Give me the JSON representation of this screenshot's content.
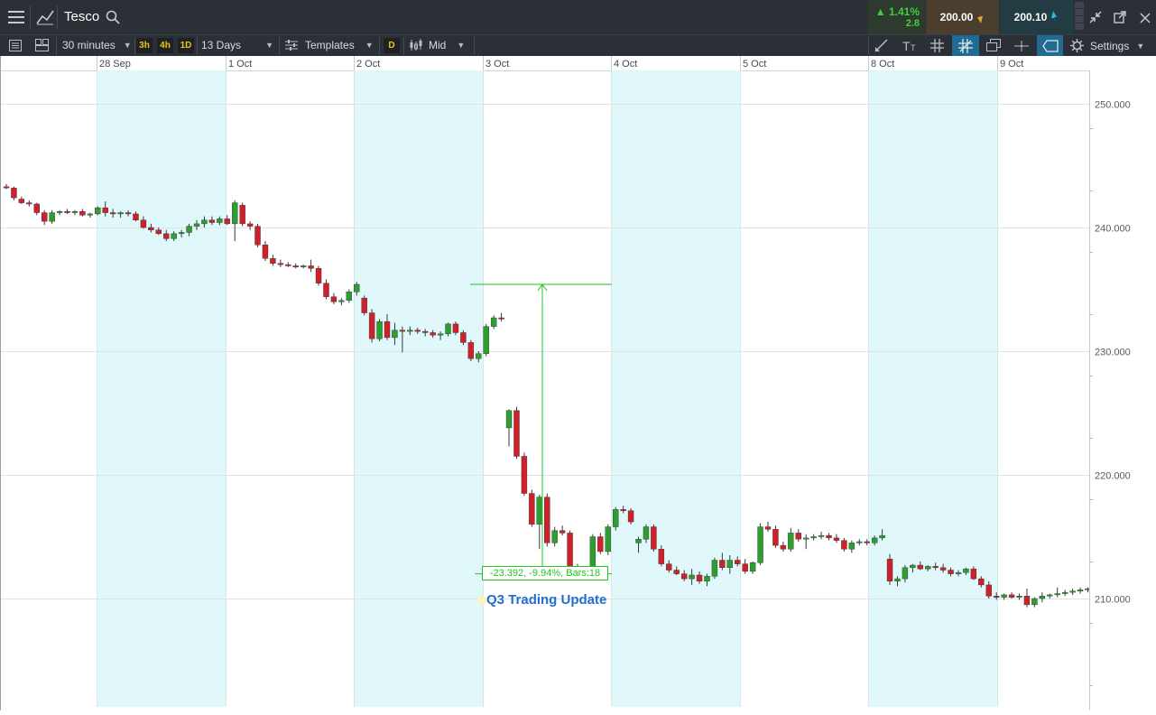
{
  "header": {
    "instrument": "Tesco",
    "change_pct": "▲ 1.41%",
    "change_abs": "2.8",
    "sell_price": "200.00",
    "buy_price": "200.10"
  },
  "toolbar": {
    "interval": "30 minutes",
    "quick_intervals": [
      "3h",
      "4h",
      "1D"
    ],
    "range": "13 Days",
    "templates_label": "Templates",
    "d_label": "D",
    "price_type": "Mid",
    "settings_label": "Settings"
  },
  "annotation": {
    "measure_label": "-23.392, -9.94%, Bars:18",
    "event_label": "Q3 Trading Update"
  },
  "colors": {
    "up": "#2e9e2e",
    "down": "#d0202a",
    "shade": "#e0f8fa",
    "measure": "#22c422",
    "event": "#1f6fd1",
    "toolbar_bg": "#2b2f36"
  },
  "chart_data": {
    "type": "candlestick",
    "dates": [
      "28 Sep",
      "1 Oct",
      "2 Oct",
      "3 Oct",
      "4 Oct",
      "5 Oct",
      "8 Oct",
      "9 Oct"
    ],
    "ylim": [
      203,
      253
    ],
    "yticks": [
      210,
      220,
      230,
      240,
      250
    ],
    "ytick_labels": [
      "210.000",
      "220.000",
      "230.000",
      "240.000",
      "250.000"
    ],
    "grid": true,
    "shaded_days": [
      "28 Sep",
      "2 Oct",
      "4 Oct",
      "8 Oct"
    ],
    "measure": {
      "from": 235.4,
      "to": 212.0
    },
    "candles": [
      [
        243.3,
        243.5,
        243.1,
        243.2
      ],
      [
        243.2,
        243.3,
        242.2,
        242.4
      ],
      [
        242.3,
        242.5,
        241.9,
        242.0
      ],
      [
        242.0,
        242.2,
        241.7,
        241.9
      ],
      [
        241.9,
        242.0,
        241.0,
        241.2
      ],
      [
        241.2,
        241.4,
        240.2,
        240.5
      ],
      [
        240.5,
        241.4,
        240.3,
        241.2
      ],
      [
        241.2,
        241.4,
        241.0,
        241.3
      ],
      [
        241.3,
        241.5,
        241.1,
        241.2
      ],
      [
        241.2,
        241.4,
        241.0,
        241.3
      ],
      [
        241.3,
        241.5,
        240.9,
        241.0
      ],
      [
        241.0,
        241.2,
        240.8,
        241.1
      ],
      [
        241.1,
        241.7,
        241.0,
        241.6
      ],
      [
        241.6,
        242.1,
        240.9,
        241.2
      ],
      [
        241.2,
        241.5,
        240.8,
        241.1
      ],
      [
        241.1,
        241.3,
        240.8,
        241.2
      ],
      [
        241.2,
        241.4,
        240.9,
        241.1
      ],
      [
        241.1,
        241.3,
        240.5,
        240.6
      ],
      [
        240.6,
        240.9,
        239.9,
        240.0
      ],
      [
        240.0,
        240.3,
        239.6,
        239.8
      ],
      [
        239.8,
        240.0,
        239.4,
        239.5
      ],
      [
        239.5,
        239.8,
        238.9,
        239.1
      ],
      [
        239.1,
        239.7,
        238.9,
        239.5
      ],
      [
        239.5,
        239.8,
        239.2,
        239.6
      ],
      [
        239.6,
        240.3,
        239.3,
        240.1
      ],
      [
        240.1,
        240.6,
        239.8,
        240.3
      ],
      [
        240.3,
        240.9,
        240.0,
        240.6
      ],
      [
        240.6,
        240.9,
        240.2,
        240.4
      ],
      [
        240.4,
        240.9,
        240.2,
        240.7
      ],
      [
        240.7,
        241.0,
        240.2,
        240.3
      ],
      [
        240.3,
        242.2,
        238.9,
        242.0
      ],
      [
        241.8,
        242.0,
        240.1,
        240.3
      ],
      [
        240.3,
        240.5,
        239.8,
        240.1
      ],
      [
        240.1,
        240.3,
        238.4,
        238.6
      ],
      [
        238.6,
        238.9,
        237.3,
        237.5
      ],
      [
        237.5,
        237.8,
        236.9,
        237.1
      ],
      [
        237.1,
        237.4,
        236.8,
        237.0
      ],
      [
        237.0,
        237.2,
        236.8,
        236.9
      ],
      [
        236.9,
        237.1,
        236.7,
        236.8
      ],
      [
        236.8,
        237.0,
        236.7,
        236.9
      ],
      [
        236.9,
        237.4,
        236.4,
        236.7
      ],
      [
        236.7,
        236.9,
        235.3,
        235.5
      ],
      [
        235.5,
        235.8,
        234.2,
        234.4
      ],
      [
        234.4,
        234.7,
        233.8,
        234.0
      ],
      [
        234.0,
        234.3,
        233.7,
        234.1
      ],
      [
        234.1,
        235.0,
        233.9,
        234.8
      ],
      [
        234.8,
        235.6,
        234.5,
        235.4
      ],
      [
        234.3,
        234.5,
        232.9,
        233.1
      ],
      [
        233.1,
        233.4,
        230.7,
        231.0
      ],
      [
        231.0,
        232.6,
        230.8,
        232.4
      ],
      [
        232.4,
        233.0,
        230.9,
        231.1
      ],
      [
        231.1,
        232.3,
        230.5,
        231.7
      ],
      [
        231.7,
        232.0,
        229.9,
        231.6
      ],
      [
        231.6,
        232.0,
        231.3,
        231.7
      ],
      [
        231.7,
        231.9,
        231.4,
        231.6
      ],
      [
        231.6,
        231.8,
        231.2,
        231.5
      ],
      [
        231.5,
        231.7,
        231.1,
        231.3
      ],
      [
        231.3,
        231.6,
        230.9,
        231.4
      ],
      [
        231.4,
        232.3,
        231.2,
        232.2
      ],
      [
        232.2,
        232.4,
        231.3,
        231.5
      ],
      [
        231.5,
        231.7,
        230.5,
        230.7
      ],
      [
        230.7,
        230.9,
        229.2,
        229.4
      ],
      [
        229.4,
        230.0,
        229.1,
        229.8
      ],
      [
        229.8,
        232.2,
        229.6,
        232.0
      ],
      [
        232.0,
        232.9,
        231.8,
        232.7
      ],
      [
        232.7,
        233.1,
        232.4,
        232.6
      ],
      [
        223.8,
        225.3,
        222.3,
        225.2
      ],
      [
        225.2,
        225.5,
        221.3,
        221.5
      ],
      [
        221.5,
        221.8,
        218.3,
        218.5
      ],
      [
        218.5,
        218.8,
        215.8,
        216.0
      ],
      [
        216.0,
        218.4,
        214.0,
        218.2
      ],
      [
        218.2,
        218.5,
        214.2,
        214.5
      ],
      [
        214.5,
        215.8,
        214.2,
        215.5
      ],
      [
        215.5,
        215.9,
        215.1,
        215.3
      ],
      [
        215.3,
        215.5,
        212.2,
        212.4
      ],
      [
        212.4,
        212.8,
        211.9,
        212.1
      ],
      [
        212.1,
        212.4,
        211.8,
        212.2
      ],
      [
        212.2,
        215.2,
        212.0,
        215.0
      ],
      [
        215.0,
        215.3,
        213.6,
        213.8
      ],
      [
        213.8,
        216.0,
        213.5,
        215.8
      ],
      [
        215.8,
        217.4,
        215.5,
        217.2
      ],
      [
        217.2,
        217.5,
        216.9,
        217.1
      ],
      [
        217.1,
        217.3,
        216.0,
        216.2
      ],
      [
        214.5,
        215.0,
        213.7,
        214.8
      ],
      [
        214.8,
        216.0,
        214.5,
        215.8
      ],
      [
        215.8,
        216.0,
        213.8,
        214.0
      ],
      [
        214.0,
        214.3,
        212.6,
        212.8
      ],
      [
        212.8,
        213.1,
        212.1,
        212.3
      ],
      [
        212.3,
        212.6,
        211.9,
        212.0
      ],
      [
        212.0,
        212.3,
        211.4,
        211.6
      ],
      [
        211.6,
        212.4,
        211.1,
        211.9
      ],
      [
        211.9,
        212.2,
        211.2,
        211.4
      ],
      [
        211.4,
        212.0,
        211.0,
        211.8
      ],
      [
        211.8,
        213.3,
        211.6,
        213.1
      ],
      [
        213.1,
        213.7,
        212.3,
        212.5
      ],
      [
        212.5,
        213.5,
        212.0,
        213.1
      ],
      [
        213.1,
        213.4,
        212.6,
        212.8
      ],
      [
        212.8,
        213.2,
        212.0,
        212.2
      ],
      [
        212.2,
        213.0,
        212.0,
        212.9
      ],
      [
        212.9,
        216.1,
        212.7,
        215.8
      ],
      [
        215.8,
        216.2,
        215.4,
        215.6
      ],
      [
        215.6,
        215.9,
        214.1,
        214.3
      ],
      [
        214.3,
        214.6,
        213.8,
        214.0
      ],
      [
        214.0,
        215.7,
        213.8,
        215.3
      ],
      [
        215.3,
        215.6,
        214.6,
        214.8
      ],
      [
        214.8,
        215.2,
        214.0,
        214.9
      ],
      [
        214.9,
        215.2,
        214.7,
        215.0
      ],
      [
        215.0,
        215.4,
        214.8,
        215.1
      ],
      [
        215.1,
        215.3,
        214.7,
        214.9
      ],
      [
        214.9,
        215.2,
        214.5,
        214.7
      ],
      [
        214.7,
        214.9,
        213.8,
        214.0
      ],
      [
        214.0,
        214.7,
        213.7,
        214.5
      ],
      [
        214.5,
        214.8,
        214.3,
        214.6
      ],
      [
        214.6,
        214.8,
        214.3,
        214.5
      ],
      [
        214.5,
        215.1,
        214.3,
        214.9
      ],
      [
        214.9,
        215.6,
        214.7,
        215.1
      ],
      [
        213.2,
        213.6,
        211.1,
        211.4
      ],
      [
        211.4,
        211.8,
        211.0,
        211.6
      ],
      [
        211.6,
        212.7,
        211.3,
        212.5
      ],
      [
        212.5,
        212.8,
        212.1,
        212.7
      ],
      [
        212.7,
        213.0,
        212.3,
        212.4
      ],
      [
        212.4,
        212.7,
        212.2,
        212.6
      ],
      [
        212.6,
        212.9,
        212.3,
        212.5
      ],
      [
        212.5,
        212.8,
        212.1,
        212.3
      ],
      [
        212.3,
        212.5,
        211.8,
        212.0
      ],
      [
        212.0,
        212.3,
        211.8,
        212.1
      ],
      [
        212.1,
        212.5,
        211.9,
        212.4
      ],
      [
        212.4,
        212.6,
        211.5,
        211.6
      ],
      [
        211.6,
        211.8,
        210.9,
        211.1
      ],
      [
        211.1,
        211.4,
        210.0,
        210.2
      ],
      [
        210.2,
        210.5,
        209.9,
        210.1
      ],
      [
        210.1,
        210.4,
        209.9,
        210.3
      ],
      [
        210.3,
        210.5,
        210.0,
        210.1
      ],
      [
        210.1,
        210.4,
        209.9,
        210.2
      ],
      [
        210.2,
        210.8,
        209.3,
        209.5
      ],
      [
        209.5,
        210.1,
        209.3,
        210.0
      ],
      [
        210.0,
        210.5,
        209.7,
        210.2
      ],
      [
        210.2,
        210.4,
        210.0,
        210.3
      ],
      [
        210.3,
        210.9,
        210.1,
        210.4
      ],
      [
        210.4,
        210.7,
        210.2,
        210.5
      ],
      [
        210.5,
        210.8,
        210.3,
        210.6
      ],
      [
        210.6,
        210.9,
        210.4,
        210.7
      ],
      [
        210.7,
        210.9,
        210.5,
        210.8
      ],
      [
        210.8,
        211.1,
        210.6,
        210.9
      ],
      [
        210.9,
        211.2,
        210.7,
        211.0
      ],
      [
        211.0,
        211.8,
        210.8,
        211.5
      ],
      [
        211.5,
        212.3,
        211.3,
        212.1
      ]
    ]
  }
}
